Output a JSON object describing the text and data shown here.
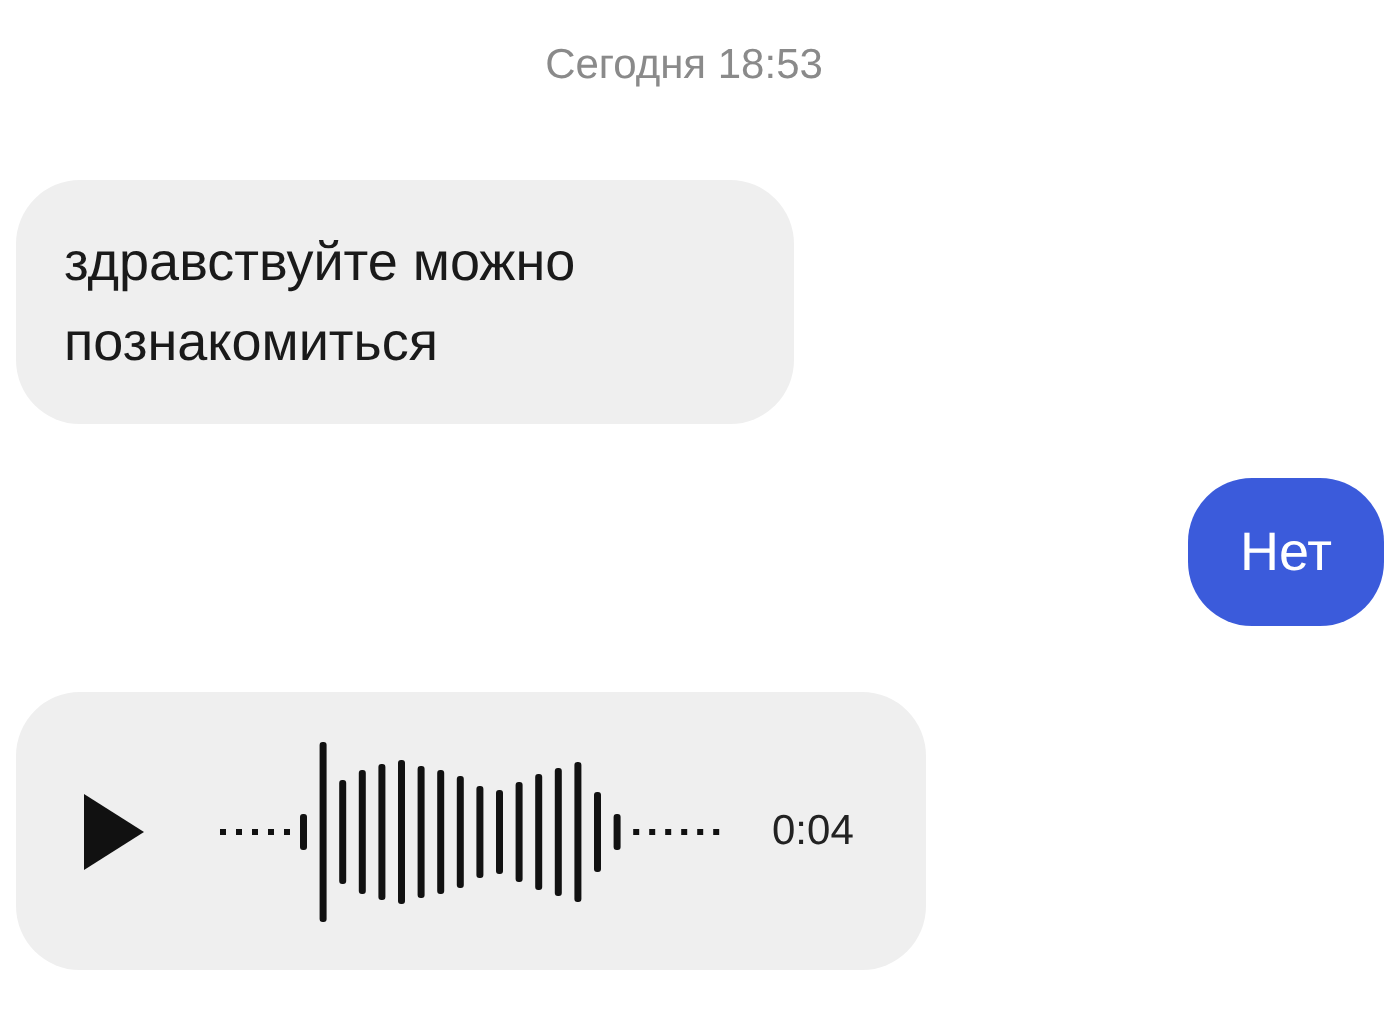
{
  "timestamp": "Сегодня 18:53",
  "messages": [
    {
      "kind": "text",
      "outgoing": false,
      "text": "здравствуйте можно познакомиться"
    },
    {
      "kind": "text",
      "outgoing": true,
      "text": "Нет"
    },
    {
      "kind": "voice",
      "outgoing": false,
      "duration": "0:04"
    }
  ]
}
